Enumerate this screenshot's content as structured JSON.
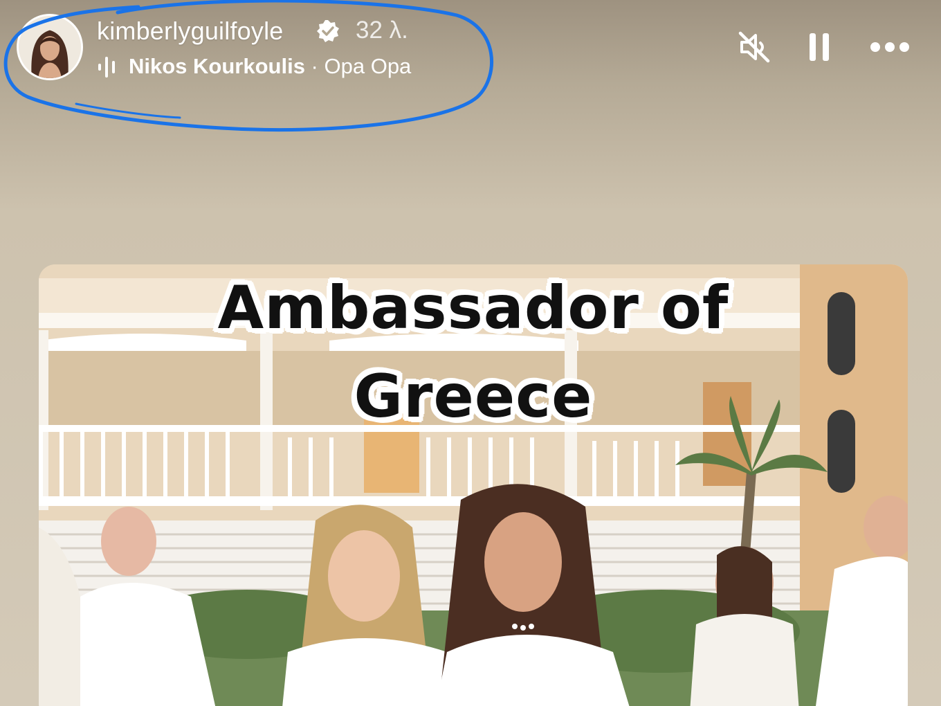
{
  "story": {
    "username": "kimberlyguilfoyle",
    "verified_icon": "verified-badge-icon",
    "timestamp": "32 λ.",
    "music": {
      "icon": "audio-wave-icon",
      "artist": "Nikos Kourkoulis",
      "separator": " · ",
      "song": "Opa Opa"
    }
  },
  "controls": {
    "mute_icon": "muted-speaker-icon",
    "pause_icon": "pause-icon",
    "more_icon": "more-options-icon"
  },
  "photo": {
    "caption_line1": "Ambassador of",
    "caption_line2": "Greece"
  },
  "colors": {
    "highlight": "#1a73e8",
    "text": "#ffffff"
  }
}
